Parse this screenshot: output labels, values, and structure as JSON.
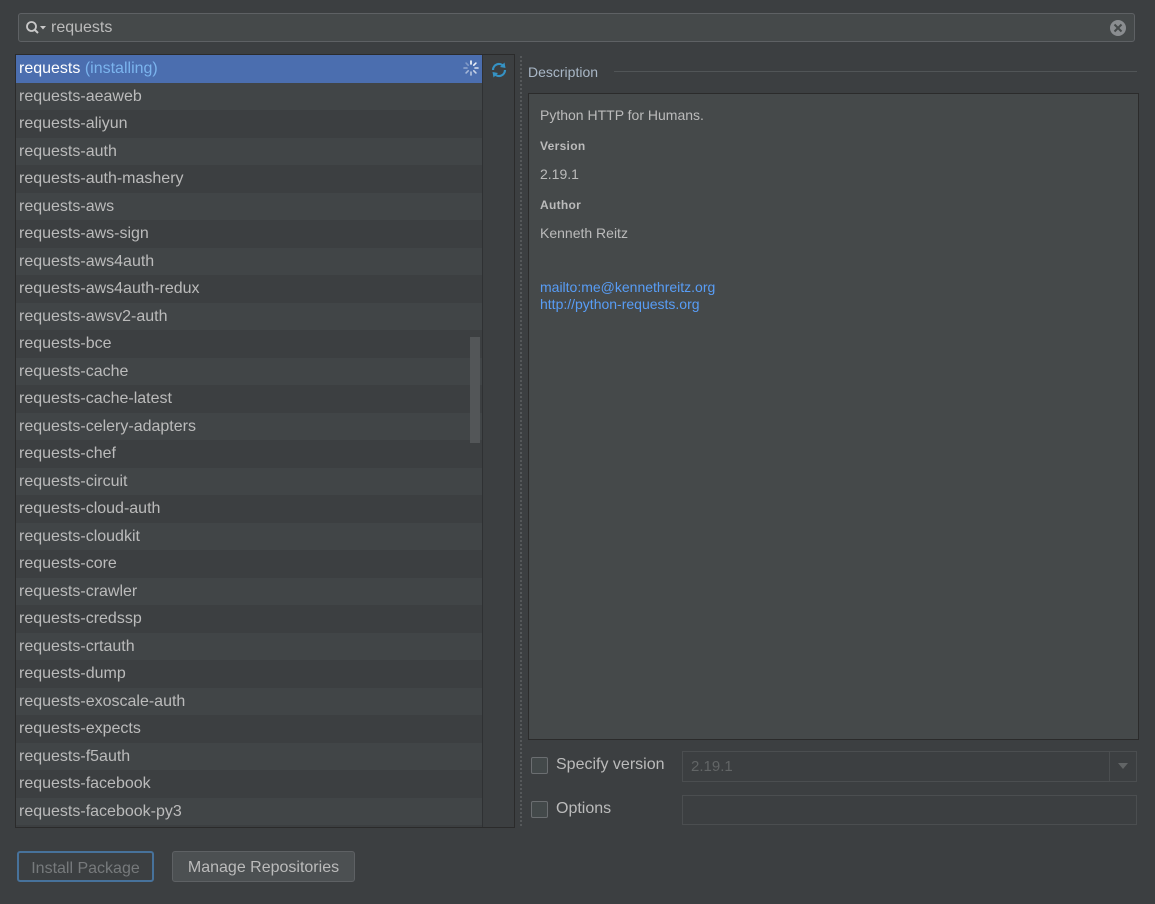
{
  "search": {
    "query": "requests"
  },
  "packages": {
    "selected": {
      "name": "requests",
      "status": "(installing)"
    },
    "items": [
      "requests-aeaweb",
      "requests-aliyun",
      "requests-auth",
      "requests-auth-mashery",
      "requests-aws",
      "requests-aws-sign",
      "requests-aws4auth",
      "requests-aws4auth-redux",
      "requests-awsv2-auth",
      "requests-bce",
      "requests-cache",
      "requests-cache-latest",
      "requests-celery-adapters",
      "requests-chef",
      "requests-circuit",
      "requests-cloud-auth",
      "requests-cloudkit",
      "requests-core",
      "requests-crawler",
      "requests-credssp",
      "requests-crtauth",
      "requests-dump",
      "requests-exoscale-auth",
      "requests-expects",
      "requests-f5auth",
      "requests-facebook",
      "requests-facebook-py3"
    ]
  },
  "description": {
    "title": "Description",
    "summary": "Python HTTP for Humans.",
    "version_label": "Version",
    "version": "2.19.1",
    "author_label": "Author",
    "author": "Kenneth Reitz",
    "email_link": "mailto:me@kennethreitz.org",
    "home_link": "http://python-requests.org"
  },
  "options": {
    "specify_version_label": "Specify version",
    "specify_version_value": "2.19.1",
    "options_label": "Options"
  },
  "buttons": {
    "install": "Install Package",
    "manage": "Manage Repositories"
  },
  "colors": {
    "background": "#3c3f41",
    "selection": "#4b6eaf",
    "link": "#589df6",
    "installing": "#7bb4ee"
  }
}
